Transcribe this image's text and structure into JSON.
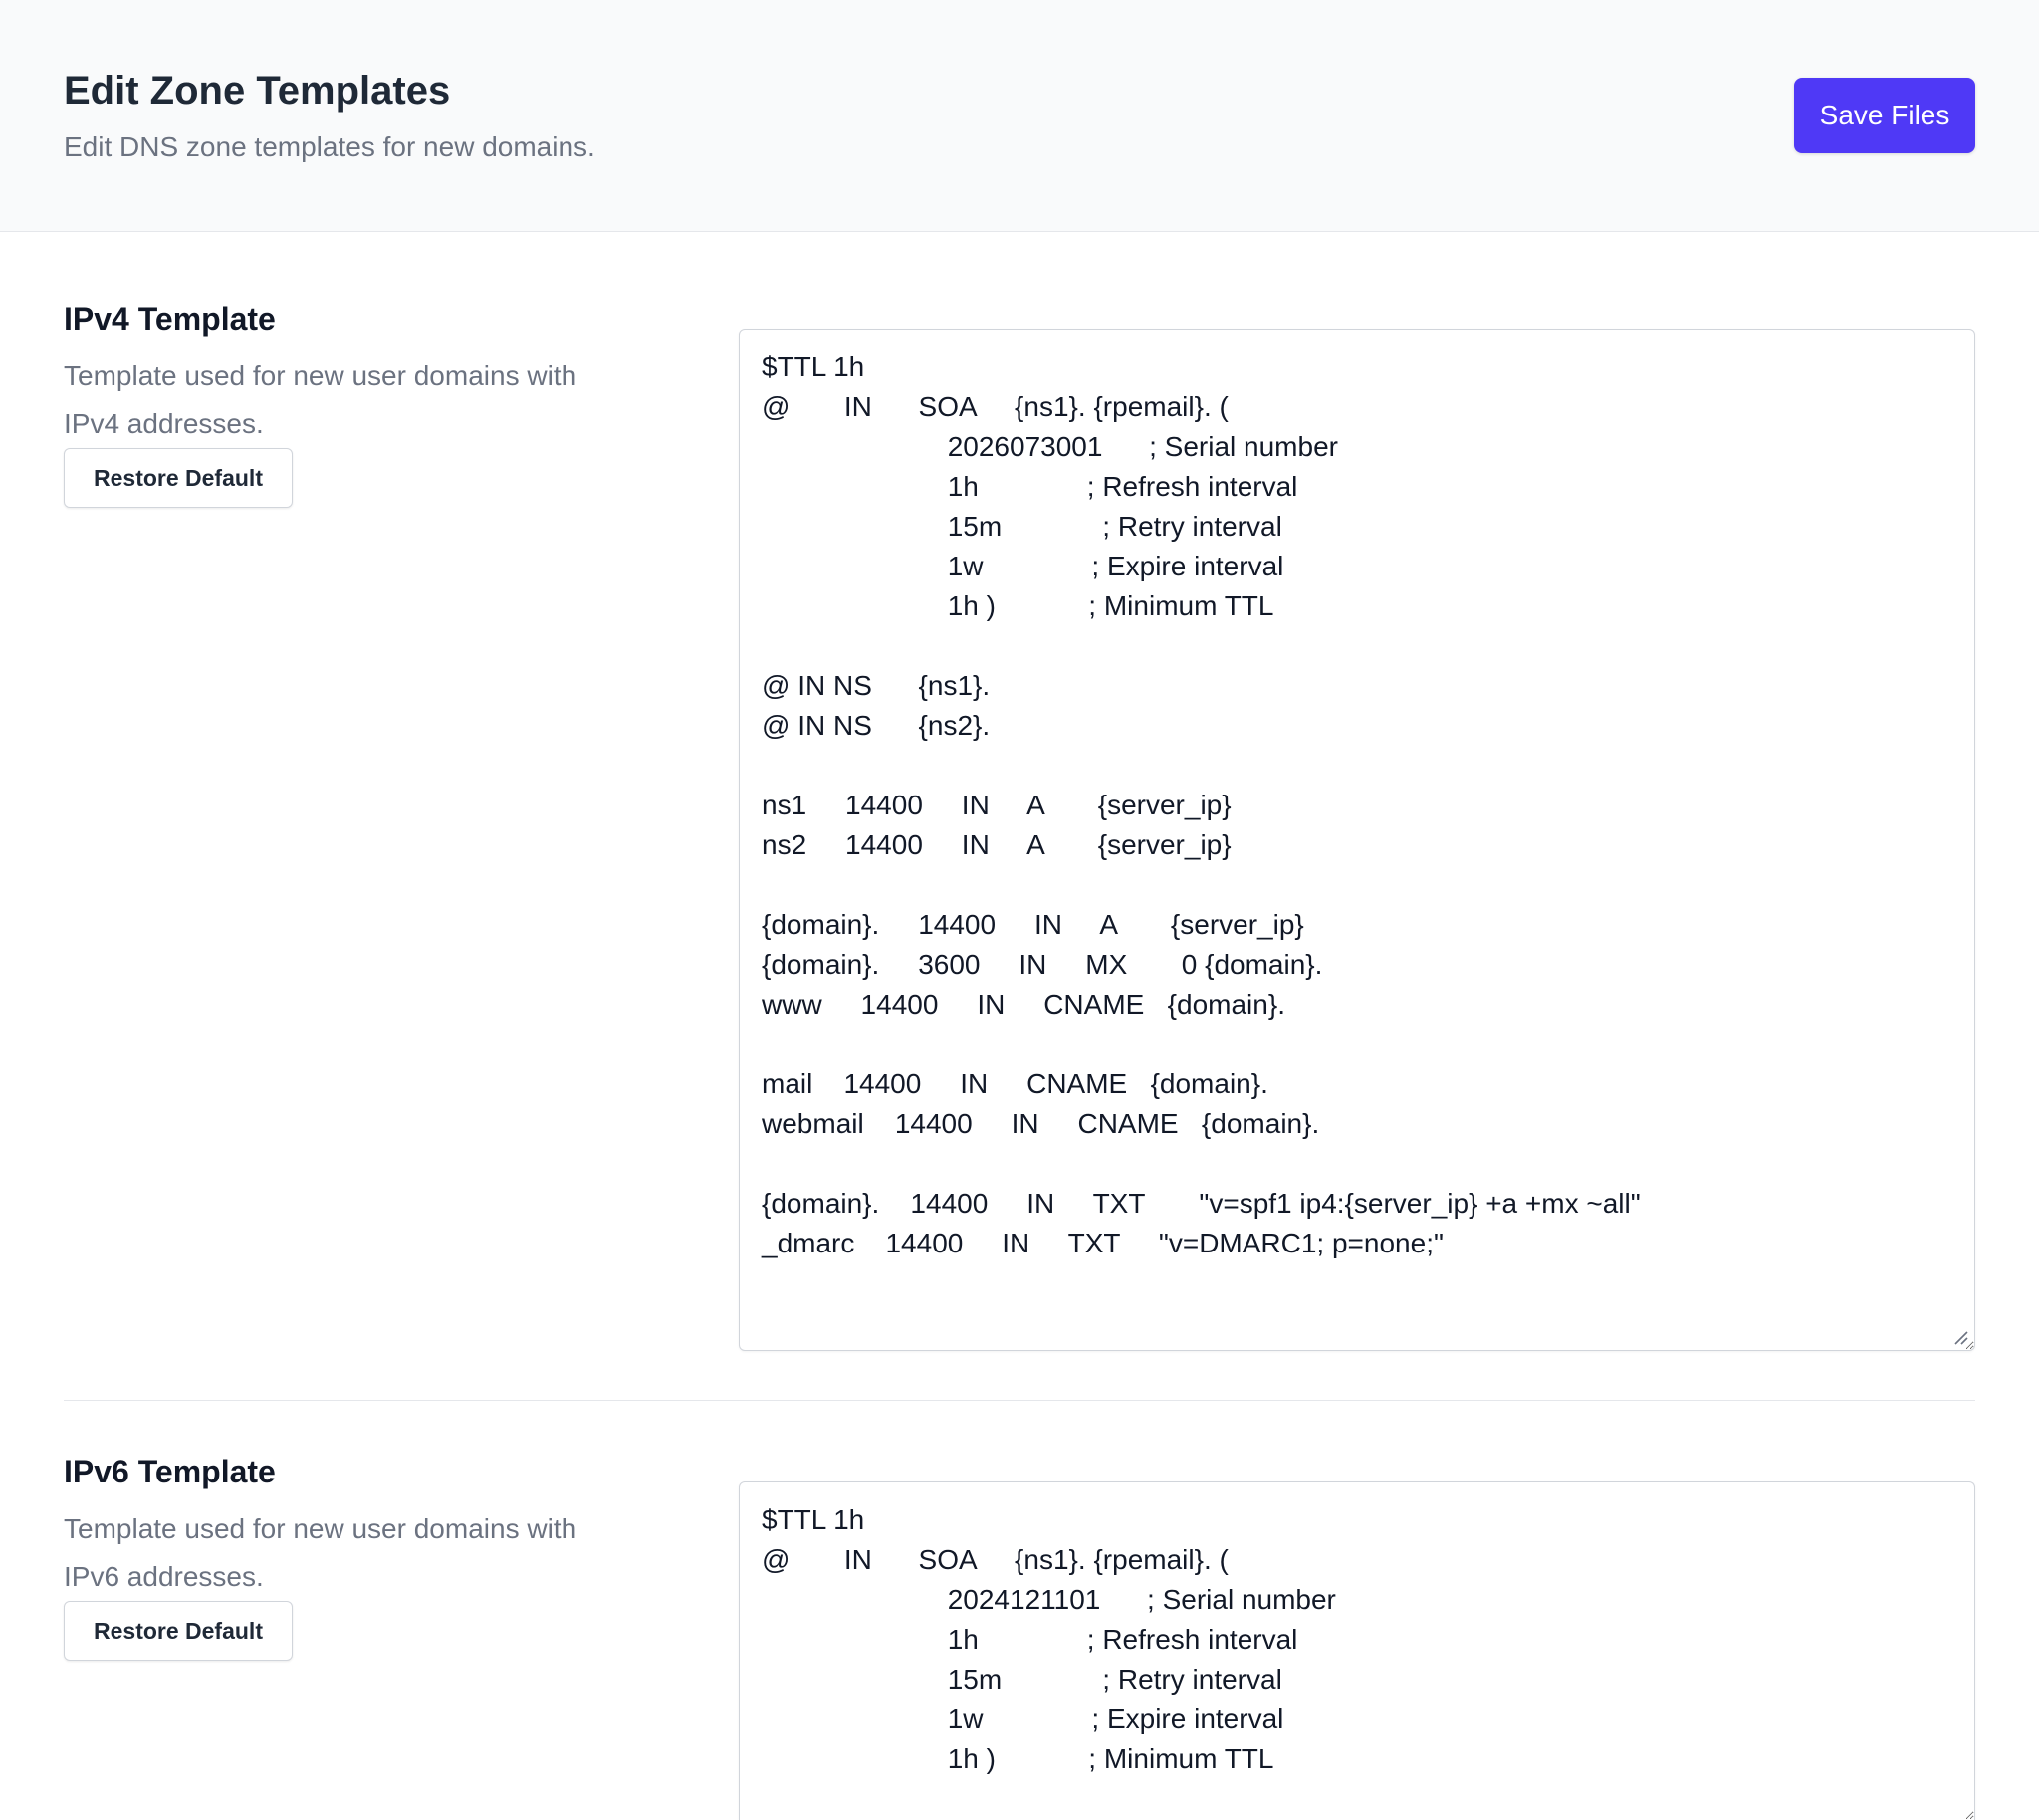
{
  "header": {
    "title": "Edit Zone Templates",
    "subtitle": "Edit DNS zone templates for new domains.",
    "save_label": "Save Files"
  },
  "sections": [
    {
      "title": "IPv4 Template",
      "description": "Template used for new user domains with IPv4 addresses.",
      "restore_label": "Restore Default",
      "content": "$TTL 1h\n@       IN      SOA     {ns1}. {rpemail}. (\n                        2026073001      ; Serial number\n                        1h              ; Refresh interval\n                        15m             ; Retry interval\n                        1w              ; Expire interval\n                        1h )            ; Minimum TTL\n\n@ IN NS      {ns1}.\n@ IN NS      {ns2}.\n\nns1     14400     IN     A       {server_ip}\nns2     14400     IN     A       {server_ip}\n\n{domain}.     14400     IN     A       {server_ip}\n{domain}.     3600     IN     MX       0 {domain}.\nwww     14400     IN     CNAME   {domain}.\n\nmail    14400     IN     CNAME   {domain}.\nwebmail    14400     IN     CNAME   {domain}.\n\n{domain}.    14400     IN     TXT       \"v=spf1 ip4:{server_ip} +a +mx ~all\"\n_dmarc    14400     IN     TXT     \"v=DMARC1; p=none;\""
    },
    {
      "title": "IPv6 Template",
      "description": "Template used for new user domains with IPv6 addresses.",
      "restore_label": "Restore Default",
      "content": "$TTL 1h\n@       IN      SOA     {ns1}. {rpemail}. (\n                        2024121101      ; Serial number\n                        1h              ; Refresh interval\n                        15m             ; Retry interval\n                        1w              ; Expire interval\n                        1h )            ; Minimum TTL"
    }
  ]
}
